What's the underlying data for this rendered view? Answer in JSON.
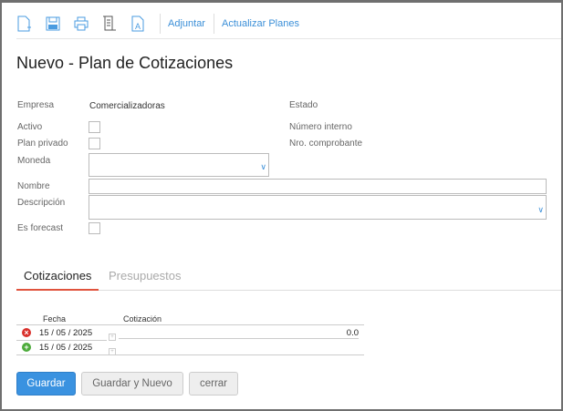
{
  "toolbar": {
    "new_icon": "new-document-icon",
    "save_icon": "save-icon",
    "print_icon": "print-icon",
    "script_icon": "scroll-icon",
    "font_icon": "text-document-icon",
    "attach": "Adjuntar",
    "update_plans": "Actualizar Planes"
  },
  "page_title": "Nuevo - Plan de Cotizaciones",
  "form": {
    "empresa_label": "Empresa",
    "empresa_value": "Comercializadoras",
    "estado_label": "Estado",
    "activo_label": "Activo",
    "numero_interno_label": "Número interno",
    "plan_privado_label": "Plan privado",
    "nro_comprobante_label": "Nro. comprobante",
    "moneda_label": "Moneda",
    "moneda_value": "",
    "nombre_label": "Nombre",
    "nombre_value": "",
    "descripcion_label": "Descripción",
    "descripcion_value": "",
    "forecast_label": "Es forecast"
  },
  "tabs": [
    {
      "label": "Cotizaciones",
      "active": true
    },
    {
      "label": "Presupuestos",
      "active": false
    }
  ],
  "table": {
    "headers": [
      "Fecha",
      "Cotización"
    ],
    "rows": [
      {
        "action": "remove",
        "fecha": "15 / 05 /  2025",
        "cotizacion": "0.0"
      },
      {
        "action": "add",
        "fecha": "15 / 05 /  2025",
        "cotizacion": ""
      }
    ]
  },
  "buttons": {
    "save": "Guardar",
    "save_new": "Guardar y Nuevo",
    "close": "cerrar"
  },
  "colors": {
    "accent": "#3a92e0",
    "tab_underline": "#e0533d",
    "remove": "#d9302b",
    "add": "#4cab3a"
  }
}
